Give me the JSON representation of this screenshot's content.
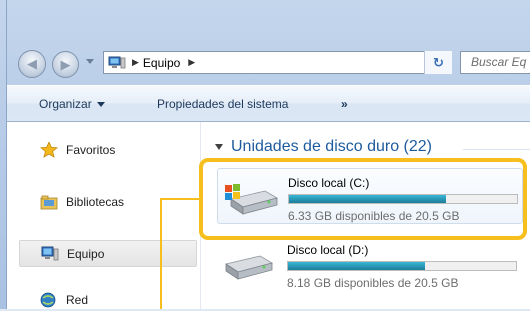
{
  "address": {
    "path_label": "Equipo",
    "search_placeholder": "Buscar Eq"
  },
  "command_bar": {
    "organize_label": "Organizar",
    "properties_label": "Propiedades del sistema",
    "more_label": "»"
  },
  "nav_pane": {
    "items": [
      {
        "label": "Favoritos",
        "icon": "star-icon"
      },
      {
        "label": "Bibliotecas",
        "icon": "library-icon"
      },
      {
        "label": "Equipo",
        "icon": "computer-icon",
        "selected": true
      },
      {
        "label": "Red",
        "icon": "network-icon"
      }
    ]
  },
  "content": {
    "group_header": "Unidades de disco duro (22)",
    "drives": [
      {
        "name": "Disco local (C:)",
        "free_text": "6.33 GB disponibles de 20.5 GB",
        "used_fraction": 0.69
      },
      {
        "name": "Disco local (D:)",
        "free_text": "8.18 GB disponibles de 20.5 GB",
        "used_fraction": 0.6
      }
    ]
  },
  "colors": {
    "highlight": "#f7bf1d",
    "group_header": "#1e5b9e",
    "drive_bar": "#2896b4"
  }
}
